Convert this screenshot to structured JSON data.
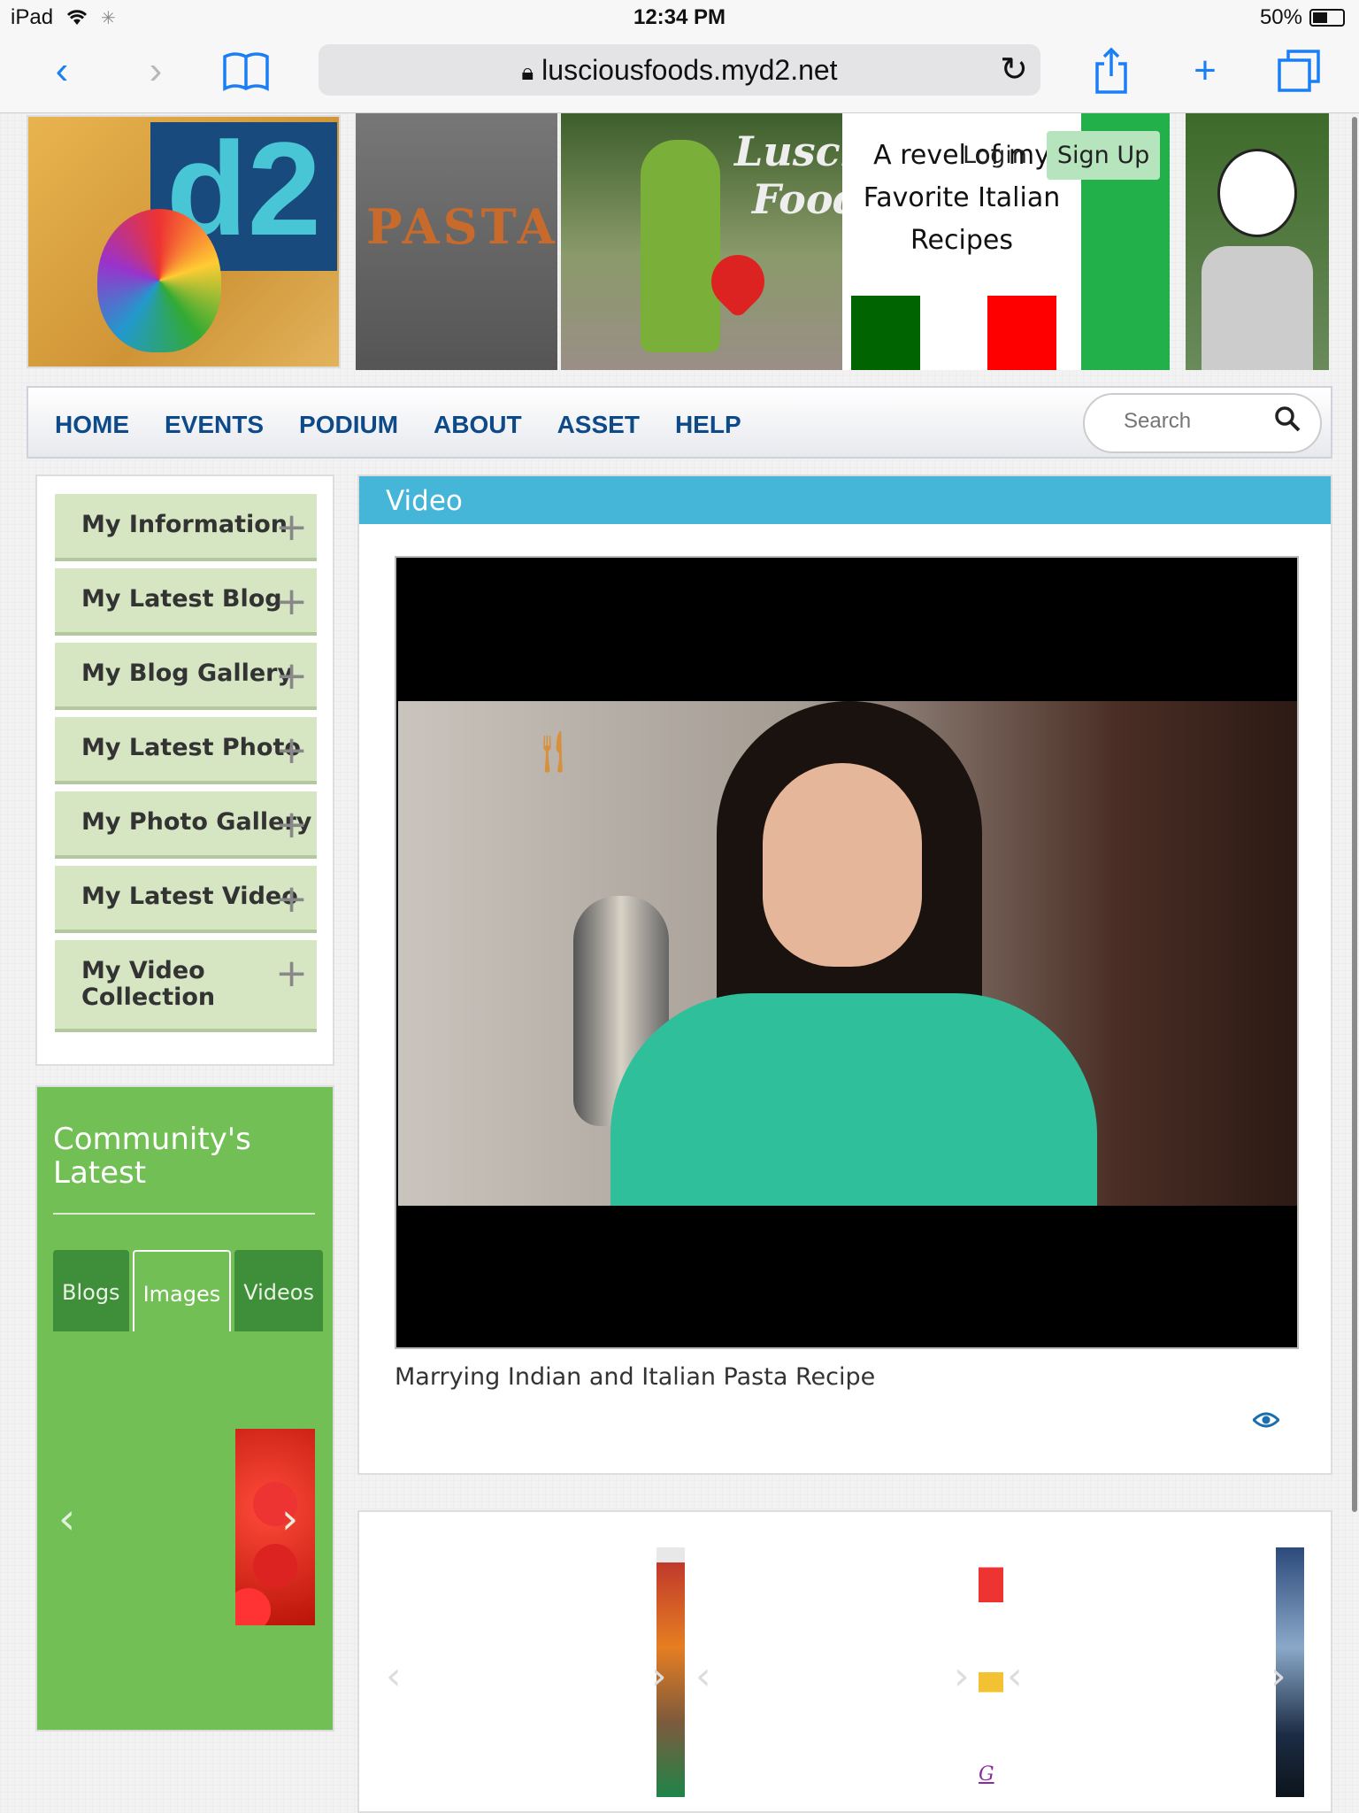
{
  "status": {
    "device": "iPad",
    "time": "12:34 PM",
    "battery": "50%"
  },
  "browser": {
    "url": "lusciousfoods.myd2.net"
  },
  "banner": {
    "pasta_text": "PASTA",
    "script_line1": "Luscious",
    "script_line2": "Foods",
    "tagline": "A revel of my Favorite Italian Recipes",
    "login": "Login",
    "signup": "Sign Up"
  },
  "nav": {
    "items": [
      "HOME",
      "EVENTS",
      "PODIUM",
      "ABOUT",
      "ASSET",
      "HELP"
    ],
    "search_placeholder": "Search"
  },
  "sidebar": {
    "items": [
      {
        "label": "My Information"
      },
      {
        "label": "My Latest Blog"
      },
      {
        "label": "My Blog Gallery"
      },
      {
        "label": "My Latest Photo"
      },
      {
        "label": "My Photo Gallery"
      },
      {
        "label": "My Latest Video"
      },
      {
        "label": "My Video Collection"
      }
    ]
  },
  "community": {
    "title": "Community's Latest",
    "tabs": [
      "Blogs",
      "Images",
      "Videos"
    ],
    "active_tab": "Images"
  },
  "video": {
    "header": "Video",
    "caption": "Marrying Indian and Italian Pasta Recipe"
  },
  "gallery": {
    "link_text": "G"
  },
  "colors": {
    "nav_text": "#0d4a8a",
    "video_header": "#45b6d8",
    "community_bg": "#72bf56",
    "sidebar_item_bg": "#d6e6c3",
    "signup_bg": "#b6e4bd",
    "ios_blue": "#1a7ef5"
  }
}
